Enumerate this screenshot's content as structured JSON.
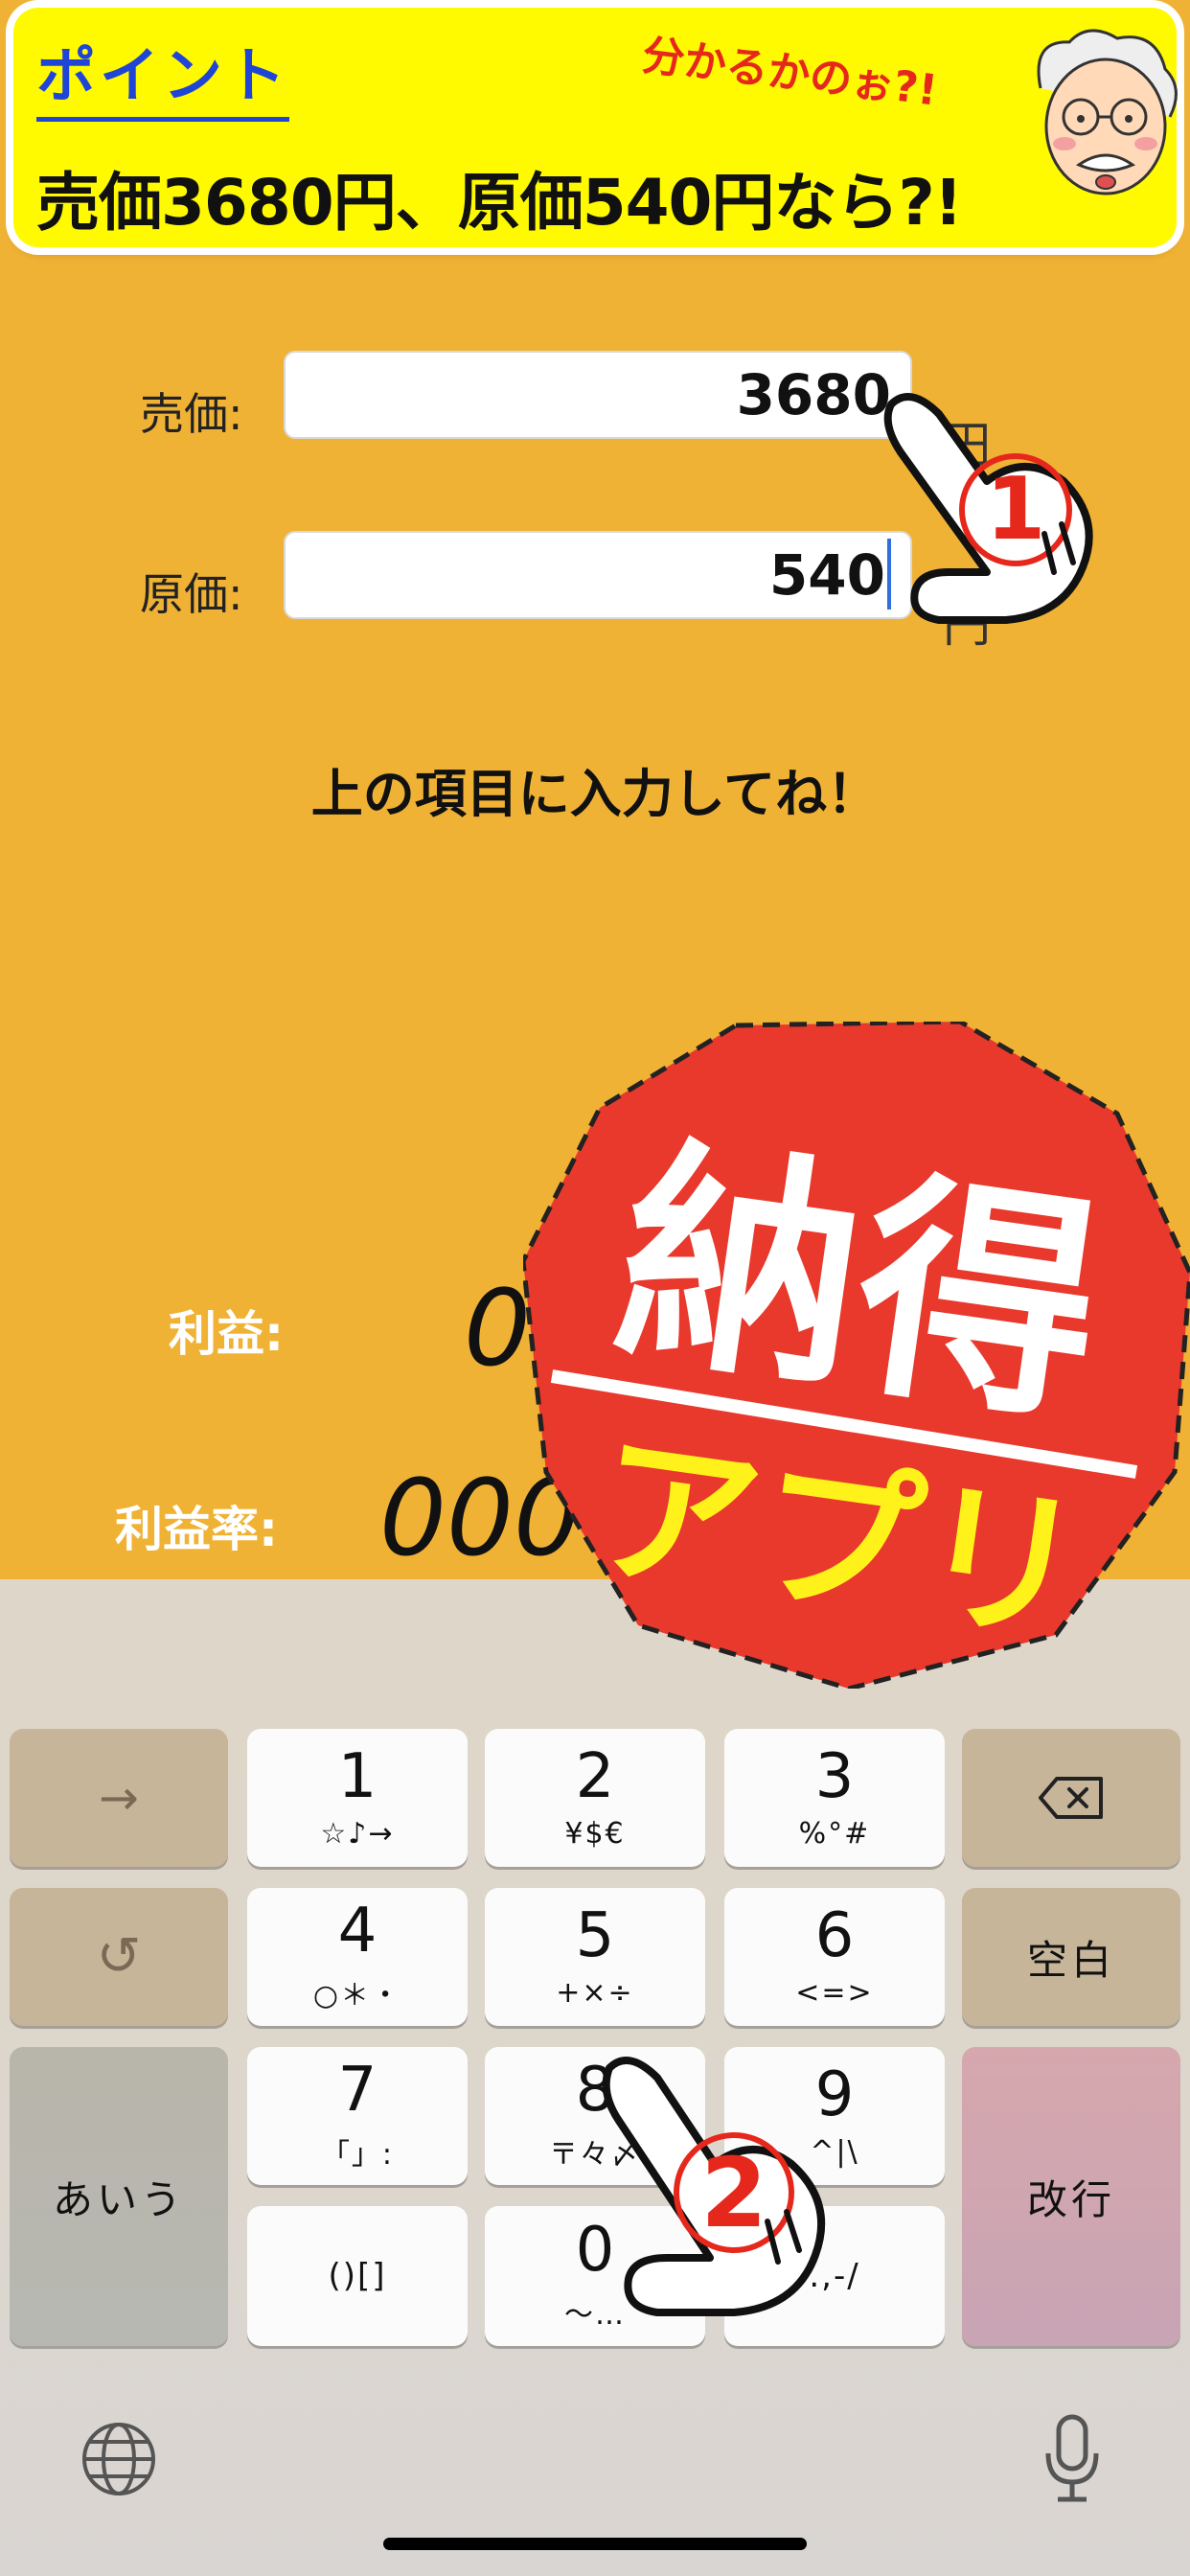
{
  "banner": {
    "title": "ポイント",
    "question": "売価3680円、原価540円なら?!",
    "catchphrase": "分かるかのぉ?!"
  },
  "form": {
    "sell_label": "売価:",
    "sell_value": "3680",
    "sell_unit": "円",
    "cost_label": "原価:",
    "cost_value": "540",
    "cost_unit": "円"
  },
  "helper_text": "上の項目に入力してね！",
  "results": {
    "profit_label": "利益:",
    "profit_value": "0",
    "rate_label": "利益率:",
    "rate_value": "000"
  },
  "stamp": {
    "main": "納得",
    "sub": "アプリ"
  },
  "markers": {
    "first": "1",
    "second": "2"
  },
  "keyboard": {
    "arrow": "→",
    "undo": "↺",
    "space": "空白",
    "kana": "あいう",
    "enter": "改行",
    "keys": [
      {
        "main": "1",
        "sub": "☆♪→"
      },
      {
        "main": "2",
        "sub": "¥$€"
      },
      {
        "main": "3",
        "sub": "%°#"
      },
      {
        "main": "4",
        "sub": "○＊・"
      },
      {
        "main": "5",
        "sub": "+×÷"
      },
      {
        "main": "6",
        "sub": "<=>"
      },
      {
        "main": "7",
        "sub": "「」:"
      },
      {
        "main": "8",
        "sub": "〒々〆"
      },
      {
        "main": "9",
        "sub": "^|\\"
      },
      {
        "main": "()[]",
        "sub": ""
      },
      {
        "main": "0",
        "sub": "〜…"
      },
      {
        "main": ".,-/",
        "sub": ""
      }
    ]
  },
  "colors": {
    "background": "#f0b234",
    "banner": "#fffa00",
    "title_blue": "#1f45d6",
    "stamp_red": "#e8392c",
    "stamp_yellow": "#fff21a"
  }
}
